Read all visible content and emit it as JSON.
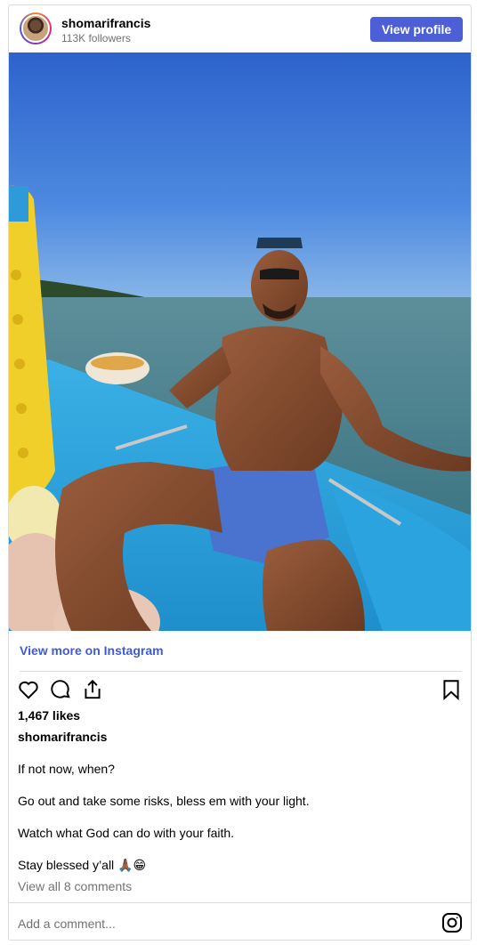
{
  "header": {
    "username": "shomarifrancis",
    "followers": "113K followers",
    "view_profile_label": "View profile"
  },
  "post": {
    "view_more_label": "View more on Instagram",
    "likes": "1,467 likes",
    "caption_user": "shomarifrancis",
    "caption_lines": [
      "If not now, when?",
      "Go out and take some risks, bless em with your light.",
      "Watch what God can do with your faith.",
      "Stay blessed y’all 🙏🏾😁"
    ],
    "comments_link": "View all 8 comments",
    "add_comment_placeholder": "Add a comment..."
  },
  "icons": [
    "heart-icon",
    "comment-icon",
    "share-icon",
    "bookmark-icon",
    "instagram-icon"
  ],
  "colors": {
    "accent": "#4c5fd7",
    "link": "#3d5bd6",
    "muted": "#737373",
    "border": "#dbdbdb"
  }
}
